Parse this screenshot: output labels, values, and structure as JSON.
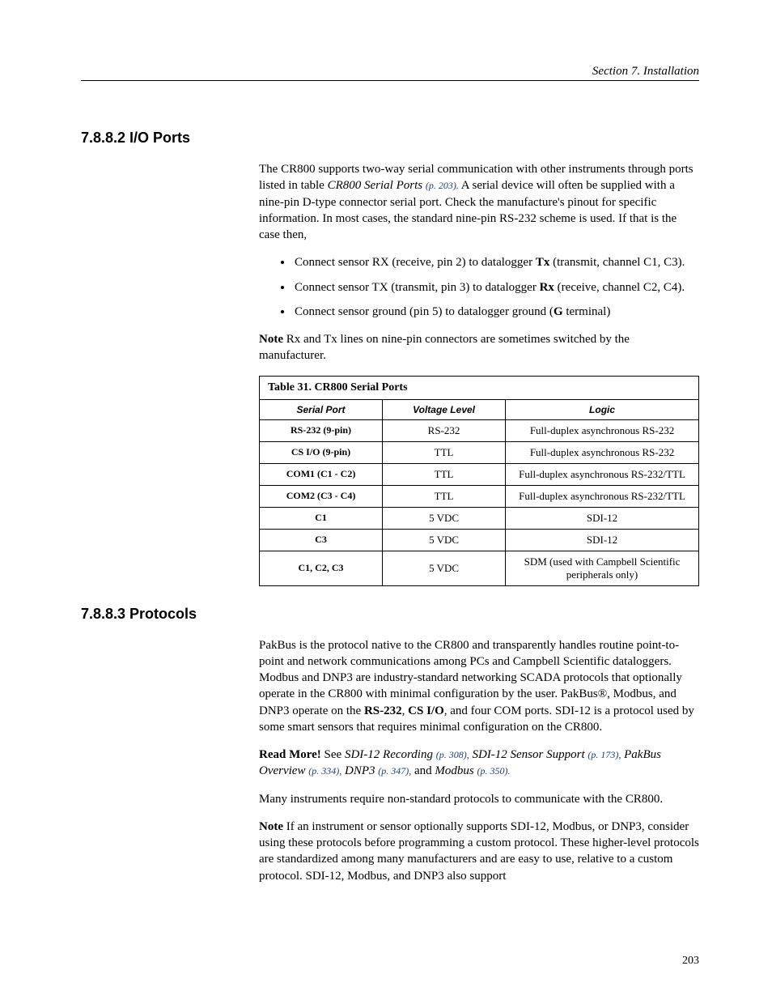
{
  "header": {
    "text": "Section 7.  Installation"
  },
  "section1": {
    "heading": "7.8.8.2 I/O Ports",
    "para1_a": "The CR800 supports two-way serial communication with other instruments through ports listed in table ",
    "para1_b": "CR800 Serial Ports ",
    "para1_link": "(p. 203).",
    "para1_c": "  A serial device will often be supplied with a nine-pin D-type connector serial port.  Check the manufacture's pinout for specific information.  In most cases, the standard nine-pin RS-232 scheme is used.  If that is the case then,",
    "bullets": {
      "b1_a": "Connect sensor RX (receive, pin 2) to datalogger ",
      "b1_b": "Tx",
      "b1_c": " (transmit, channel C1, C3).",
      "b2_a": "Connect sensor TX (transmit, pin 3) to datalogger ",
      "b2_b": "Rx",
      "b2_c": " (receive, channel C2, C4).",
      "b3_a": "Connect sensor ground (pin 5) to datalogger ground (",
      "b3_b": "G",
      "b3_c": " terminal)"
    },
    "note_label": "Note",
    "note_text": "  Rx and Tx lines on nine-pin connectors are sometimes switched by the manufacturer."
  },
  "table": {
    "title": "Table 31.  CR800 Serial Ports",
    "headers": {
      "c1": "Serial Port",
      "c2": "Voltage Level",
      "c3": "Logic"
    },
    "rows": [
      {
        "c1": "RS-232 (9-pin)",
        "c2": "RS-232",
        "c3": "Full-duplex asynchronous RS-232"
      },
      {
        "c1": "CS I/O (9-pin)",
        "c2": "TTL",
        "c3": "Full-duplex asynchronous RS-232"
      },
      {
        "c1": "COM1 (C1 - C2)",
        "c2": "TTL",
        "c3": "Full-duplex asynchronous RS-232/TTL"
      },
      {
        "c1": "COM2 (C3 - C4)",
        "c2": "TTL",
        "c3": "Full-duplex asynchronous RS-232/TTL"
      },
      {
        "c1": "C1",
        "c2": "5 VDC",
        "c3": "SDI-12"
      },
      {
        "c1": "C3",
        "c2": "5 VDC",
        "c3": "SDI-12"
      },
      {
        "c1": "C1, C2, C3",
        "c2": "5 VDC",
        "c3": "SDM (used with Campbell Scientific peripherals only)"
      }
    ]
  },
  "section2": {
    "heading": "7.8.8.3 Protocols",
    "para1_a": "PakBus is the protocol native to the CR800 and transparently handles routine point-to-point and network communications among PCs and Campbell Scientific dataloggers.  Modbus and DNP3 are industry-standard networking SCADA protocols that optionally operate in the CR800 with minimal configuration by the user.  PakBus®, Modbus, and DNP3 operate on the ",
    "para1_b": "RS-232",
    "para1_c": ", ",
    "para1_d": "CS I/O",
    "para1_e": ", and four COM ports.  SDI-12 is a protocol used by some smart sensors that requires minimal configuration on the CR800.",
    "read_label": "Read More!",
    "read_a": " See ",
    "read_l1": "SDI-12 Recording ",
    "read_p1": "(p. 308),",
    "read_l2": " SDI-12 Sensor Support ",
    "read_p2": "(p. 173),",
    "read_l3": " PakBus Overview ",
    "read_p3": "(p. 334),",
    "read_l4": " DNP3 ",
    "read_p4": "(p. 347),",
    "read_b": " and ",
    "read_l5": "Modbus ",
    "read_p5": "(p. 350).",
    "para2": "Many instruments require non-standard protocols to communicate with the CR800.",
    "note_label": "Note",
    "note_text": "  If an instrument or sensor optionally supports SDI-12, Modbus, or DNP3, consider using these protocols before programming a custom protocol. These higher-level protocols are standardized among many manufacturers and are easy to use, relative to a custom protocol.  SDI-12, Modbus, and DNP3 also support"
  },
  "page_number": "203"
}
